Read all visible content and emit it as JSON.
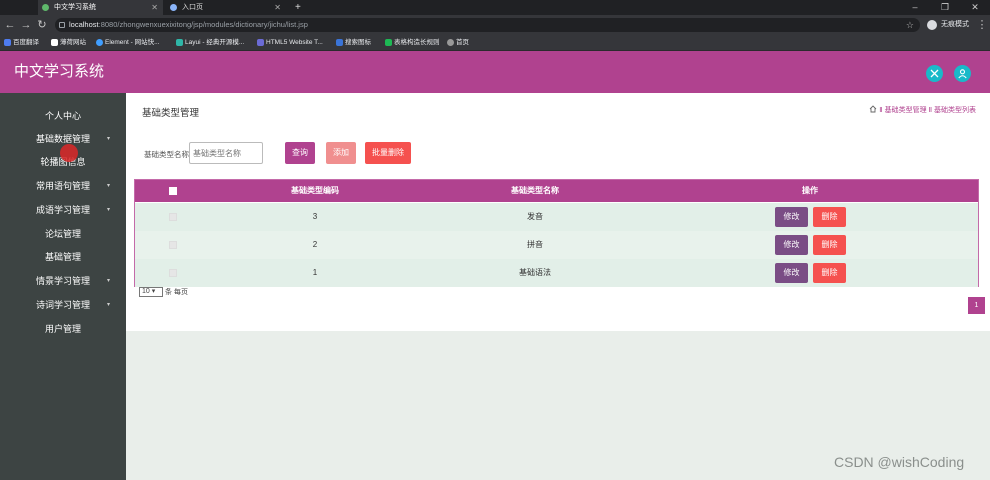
{
  "browser": {
    "tabs": [
      "中文学习系统",
      "入口页"
    ],
    "url_host": "localhost",
    "url_rest": ":8080/zhongwenxuexixitong/jsp/modules/dictionary/jichu/list.jsp",
    "profile_label": "无痕模式",
    "bookmarks": [
      "百度翻译",
      "薄荷网站",
      "Element - 网站快...",
      "Layui - 经典开源模...",
      "HTML5 Website T...",
      "搜索图标",
      "表格构造长规则",
      "首页"
    ]
  },
  "app": {
    "title": "中文学习系统",
    "colors": {
      "primary": "#b0428f",
      "sidebar": "#3d4443",
      "header_icon": "#19b9c9",
      "danger": "#f5514f",
      "edit": "#7a4d85"
    }
  },
  "sidebar": {
    "items": [
      "个人中心",
      "基础数据管理",
      "轮播图信息",
      "常用语句管理",
      "成语学习管理",
      "论坛管理",
      "基础管理",
      "情景学习管理",
      "诗词学习管理",
      "用户管理"
    ]
  },
  "page": {
    "title": "基础类型管理",
    "breadcrumb": "Ⅱ 基础类型管理 Ⅱ 基础类型列表"
  },
  "search": {
    "label": "基础类型名称",
    "placeholder": "基础类型名称",
    "query_button": "查询",
    "add_button": "添加",
    "batch_delete_button": "批量删除"
  },
  "table": {
    "headers": [
      "基础类型编码",
      "基础类型名称",
      "操作"
    ],
    "rows": [
      {
        "code": "3",
        "name": "发音"
      },
      {
        "code": "2",
        "name": "拼音"
      },
      {
        "code": "1",
        "name": "基础语法"
      }
    ],
    "edit_label": "修改",
    "delete_label": "删除"
  },
  "pagination": {
    "page_size": "10",
    "page_size_suffix": "条 每页",
    "current_page": "1"
  },
  "watermark": "CSDN @wishCoding"
}
